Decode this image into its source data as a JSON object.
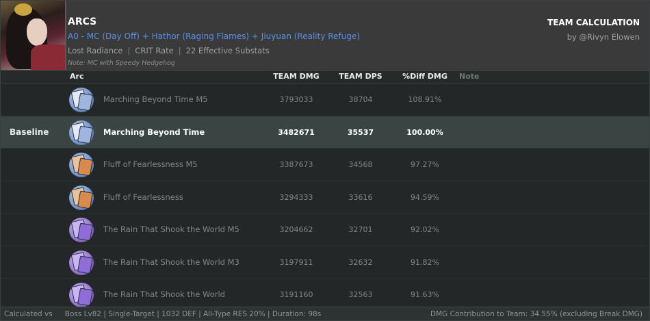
{
  "header": {
    "title": "ARCS",
    "team": "A0 - MC (Day Off) + Hathor (Raging Flames) + Jiuyuan (Reality Refuge)",
    "stats": [
      "Lost Radiance",
      "CRIT Rate",
      "22 Effective Substats"
    ],
    "note": "Note: MC with Speedy Hedgehog",
    "calc_title": "TEAM CALCULATION",
    "author": "by @Rivyn Elowen",
    "accent_color": "#5a8fe6"
  },
  "columns": {
    "arc": "Arc",
    "team_dmg": "TEAM DMG",
    "team_dps": "TEAM DPS",
    "diff_dmg": "%Diff DMG",
    "note": "Note"
  },
  "rows": [
    {
      "label": "",
      "icon": "lightcone-blue-icon",
      "name": "Marching Beyond Time M5",
      "team_dmg": "3793033",
      "team_dps": "38704",
      "diff": "108.91%"
    },
    {
      "label": "Baseline",
      "icon": "lightcone-blue-icon",
      "name": "Marching Beyond Time",
      "team_dmg": "3482671",
      "team_dps": "35537",
      "diff": "100.00%"
    },
    {
      "label": "",
      "icon": "lightcone-orange-icon",
      "name": "Fluff of Fearlessness M5",
      "team_dmg": "3387673",
      "team_dps": "34568",
      "diff": "97.27%"
    },
    {
      "label": "",
      "icon": "lightcone-orange-icon",
      "name": "Fluff of Fearlessness",
      "team_dmg": "3294333",
      "team_dps": "33616",
      "diff": "94.59%"
    },
    {
      "label": "",
      "icon": "lightcone-purple-icon",
      "name": "The Rain That Shook the World M5",
      "team_dmg": "3204662",
      "team_dps": "32701",
      "diff": "92.02%"
    },
    {
      "label": "",
      "icon": "lightcone-purple-icon",
      "name": "The Rain That Shook the World M3",
      "team_dmg": "3197911",
      "team_dps": "32632",
      "diff": "91.82%"
    },
    {
      "label": "",
      "icon": "lightcone-purple-icon",
      "name": "The Rain That Shook the World",
      "team_dmg": "3191160",
      "team_dps": "32563",
      "diff": "91.63%"
    }
  ],
  "footer": {
    "left_prefix": "Calculated vs",
    "left_text": "Boss Lv82 | Single-Target | 1032 DEF | All-Type RES 20% | Duration: 98s",
    "right_text": "DMG Contribution to Team: 34.55% (excluding Break DMG)"
  }
}
